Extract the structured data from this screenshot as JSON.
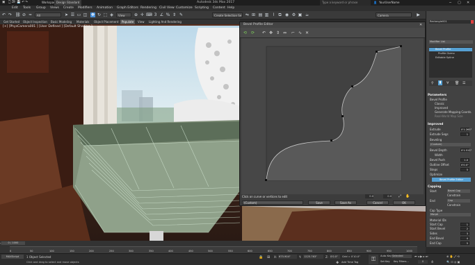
{
  "app": {
    "title": "Autodesk 3ds Max 2017",
    "workspace": "Design Standard",
    "search_placeholder": "Type a keyword or phrase",
    "user": "YourUserName"
  },
  "menu": [
    "Edit",
    "Tools",
    "Group",
    "Views",
    "Create",
    "Modifiers",
    "Animation",
    "Graph Editors",
    "Rendering",
    "Civil View",
    "Customize",
    "Scripting",
    "Content",
    "Help"
  ],
  "toolbar": {
    "filter": "All",
    "coord_system": "View",
    "selection_set": "Create Selection Se",
    "camera_dropdown": "Camera"
  },
  "ribbon_tabs": [
    "Get Started",
    "Object Inspection",
    "Basic Modeling",
    "Materials",
    "Object Placement",
    "Populate",
    "View",
    "Lighting And Rendering"
  ],
  "viewport_label": "[+] [PhysCamera001 ] [User Defined ] [Default Shading ]",
  "dialog": {
    "title": "Bevel Profile Editor",
    "status": "Click on curve or vertices to edit",
    "preset": "(Custom)",
    "field1": "0.0",
    "field2": "0.0",
    "buttons": {
      "save": "Save",
      "save_as": "Save As",
      "cancel": "Cancel",
      "ok": "OK"
    }
  },
  "cmd": {
    "object_name": "Rectangle001",
    "modifier_list": "Modifier List",
    "stack": [
      "Bevel Profile",
      "Profile Gizmo",
      "Editable Spline"
    ],
    "parameters_header": "Parameters",
    "bevel_profile_label": "Bevel Profile",
    "opt_classic": "Classic",
    "opt_improved": "Improved",
    "gen_mapping": "Generate Mapping Coords.",
    "real_world": "Real-World Map Size",
    "improved_header": "Improved",
    "extrude_label": "Extrude",
    "extrude_value": "0'1.265\"",
    "extrude_segs_label": "Extrude Segs",
    "extrude_segs_value": "1",
    "beveling_label": "Beveling",
    "beveling_value": "(Custom)",
    "bevel_depth_label": "Bevel Depth",
    "bevel_depth_value": "0'1.515\"",
    "width_label": "Width",
    "bevel_push_label": "Bevel Push",
    "bevel_push_value": "1.0",
    "outline_offset_label": "Outline Offset",
    "outline_offset_value": "0'0.0\"",
    "steps_label": "Steps",
    "steps_value": "5",
    "optimize": "Optimize",
    "editor_button": "Bevel Profile Editor",
    "capping_header": "Capping",
    "start_label": "Start",
    "start_value": "Bevel Cap",
    "end_label": "End",
    "end_value": "Cap",
    "constrain": "Constrain",
    "cap_type_label": "Cap Type",
    "cap_type_value": "Morph",
    "material_ids": "Material IDs",
    "start_cap": "Start Cap",
    "start_bevel": "Start Bevel",
    "sides": "Sides",
    "end_bevel": "End Bevel",
    "end_cap": "End Cap",
    "id_values": [
      "1",
      "2",
      "3",
      "4",
      "5"
    ]
  },
  "timeline": {
    "frame": "0 / 1000",
    "ticks": [
      "0",
      "50",
      "100",
      "150",
      "200",
      "250",
      "300",
      "350",
      "400",
      "450",
      "500",
      "550",
      "600",
      "650",
      "700",
      "750",
      "800",
      "850",
      "900",
      "950",
      "1000"
    ]
  },
  "status": {
    "selected": "1 Object Selected",
    "hint": "Click and drag to select and move objects",
    "x_label": "X:",
    "x": "675.904\"",
    "y_label": "Y:",
    "y": "1225.763\"",
    "z_label": "Z:",
    "z": "0'0.0\"",
    "grid": "Grid = 0'10.0\"",
    "auto_key": "Auto Key",
    "selected_dd": "Selected",
    "set_key": "Set Key",
    "key_filters": "Key Filters...",
    "add_time_tag": "Add Time Tag",
    "frame_field": "0"
  },
  "colors": {
    "accent": "#4a90d9",
    "active_tab": "#56a0d3"
  }
}
